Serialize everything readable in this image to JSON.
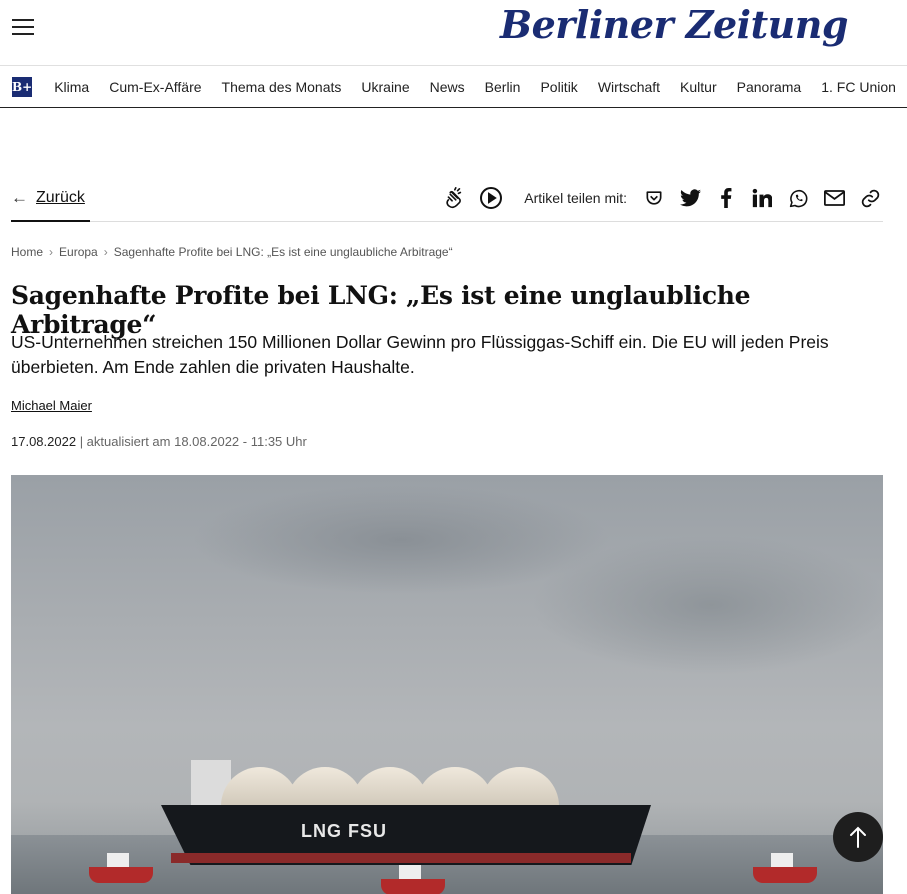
{
  "header": {
    "logo_text": "Berliner Zeitung",
    "bplus_label": "B+"
  },
  "nav": {
    "items": [
      "Klima",
      "Cum-Ex-Affäre",
      "Thema des Monats",
      "Ukraine",
      "News",
      "Berlin",
      "Politik",
      "Wirtschaft",
      "Kultur",
      "Panorama",
      "1. FC Union"
    ]
  },
  "toolbar": {
    "back_label": "Zurück",
    "share_label": "Artikel teilen mit:"
  },
  "breadcrumb": {
    "home": "Home",
    "section": "Europa",
    "current": "Sagenhafte Profite bei LNG: „Es ist eine unglaubliche Arbitrage“"
  },
  "article": {
    "headline": "Sagenhafte Profite bei LNG: „Es ist eine unglaubliche Arbitrage“",
    "lead": "US-Unternehmen streichen 150 Millionen Dollar Gewinn pro Flüssiggas-Schiff ein. Die EU will jeden Preis überbieten. Am Ende zahlen die privaten Haushalte.",
    "author": "Michael Maier",
    "published": "17.08.2022",
    "updated": " | aktualisiert am 18.08.2022 - 11:35 Uhr"
  },
  "image": {
    "ship_label": "LNG FSU"
  },
  "colors": {
    "brand": "#1a2c73",
    "text": "#111111",
    "muted": "#666666"
  }
}
